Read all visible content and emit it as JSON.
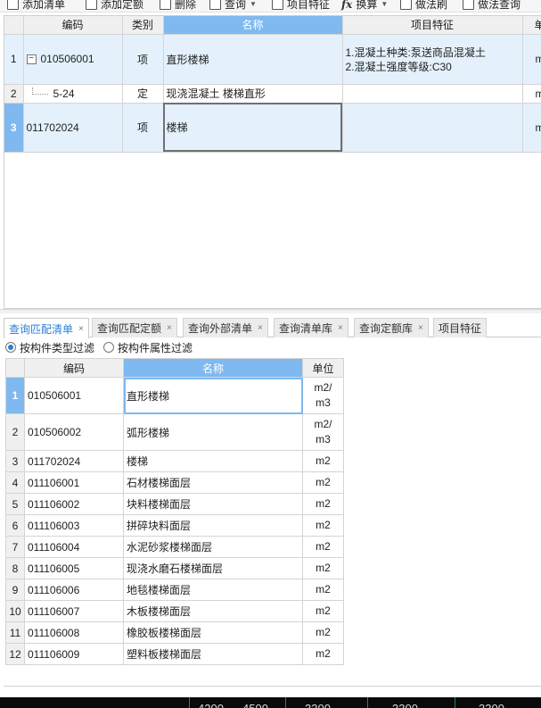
{
  "toolbar": {
    "items": [
      {
        "label": "添加清单",
        "icon": "add-list-icon"
      },
      {
        "label": "添加定额",
        "icon": "add-quota-icon"
      },
      {
        "label": "删除",
        "icon": "delete-icon"
      },
      {
        "label": "查询",
        "icon": "query-icon"
      },
      {
        "label": "项目特征",
        "icon": "item-feature-icon"
      },
      {
        "label": "换算",
        "icon": "fx-icon"
      },
      {
        "label": "做法刷",
        "icon": "brush-icon"
      },
      {
        "label": "做法查询",
        "icon": "method-query-icon"
      }
    ]
  },
  "top_grid": {
    "columns": [
      "编码",
      "类别",
      "名称",
      "项目特征",
      "单"
    ],
    "selected_column": "名称",
    "rows": [
      {
        "no": "1",
        "code": "010506001",
        "type": "项",
        "name": "直形楼梯",
        "feature_lines": [
          "1.混凝土种类:泵送商品混凝土",
          "2.混凝土强度等级:C30"
        ],
        "unit": "m"
      },
      {
        "no": "2",
        "code": "5-24",
        "type": "定",
        "name": "现浇混凝土 楼梯直形",
        "feature_lines": [],
        "unit": "m"
      },
      {
        "no": "3",
        "code": "011702024",
        "type": "项",
        "name": "楼梯",
        "feature_lines": [],
        "unit": "m"
      }
    ]
  },
  "tabs": [
    {
      "label": "查询匹配清单",
      "active": true
    },
    {
      "label": "查询匹配定额",
      "active": false
    },
    {
      "label": "查询外部清单",
      "active": false
    },
    {
      "label": "查询清单库",
      "active": false
    },
    {
      "label": "查询定额库",
      "active": false
    },
    {
      "label": "项目特征",
      "active": false
    }
  ],
  "filters": {
    "option1": "按构件类型过滤",
    "option2": "按构件属性过滤",
    "selected": "option1"
  },
  "bottom_grid": {
    "columns": [
      "编码",
      "名称",
      "单位"
    ],
    "selected_column": "名称",
    "rows": [
      {
        "no": "1",
        "code": "010506001",
        "name": "直形楼梯",
        "unit_lines": [
          "m2/",
          "m3"
        ]
      },
      {
        "no": "2",
        "code": "010506002",
        "name": "弧形楼梯",
        "unit_lines": [
          "m2/",
          "m3"
        ]
      },
      {
        "no": "3",
        "code": "011702024",
        "name": "楼梯",
        "unit_lines": [
          "m2"
        ]
      },
      {
        "no": "4",
        "code": "011106001",
        "name": "石材楼梯面层",
        "unit_lines": [
          "m2"
        ]
      },
      {
        "no": "5",
        "code": "011106002",
        "name": "块料楼梯面层",
        "unit_lines": [
          "m2"
        ]
      },
      {
        "no": "6",
        "code": "011106003",
        "name": "拼碎块料面层",
        "unit_lines": [
          "m2"
        ]
      },
      {
        "no": "7",
        "code": "011106004",
        "name": "水泥砂浆楼梯面层",
        "unit_lines": [
          "m2"
        ]
      },
      {
        "no": "8",
        "code": "011106005",
        "name": "现浇水磨石楼梯面层",
        "unit_lines": [
          "m2"
        ]
      },
      {
        "no": "9",
        "code": "011106006",
        "name": "地毯楼梯面层",
        "unit_lines": [
          "m2"
        ]
      },
      {
        "no": "10",
        "code": "011106007",
        "name": "木板楼梯面层",
        "unit_lines": [
          "m2"
        ]
      },
      {
        "no": "11",
        "code": "011106008",
        "name": "橡胶板楼梯面层",
        "unit_lines": [
          "m2"
        ]
      },
      {
        "no": "12",
        "code": "011106009",
        "name": "塑料板楼梯面层",
        "unit_lines": [
          "m2"
        ]
      }
    ]
  },
  "cad_labels": [
    "4200",
    "4500",
    "3300",
    "3300",
    "3300"
  ],
  "colors": {
    "accent": "#7fb9ef",
    "row_highlight": "#e4f1fc",
    "tab_active_text": "#2a7fd4"
  }
}
